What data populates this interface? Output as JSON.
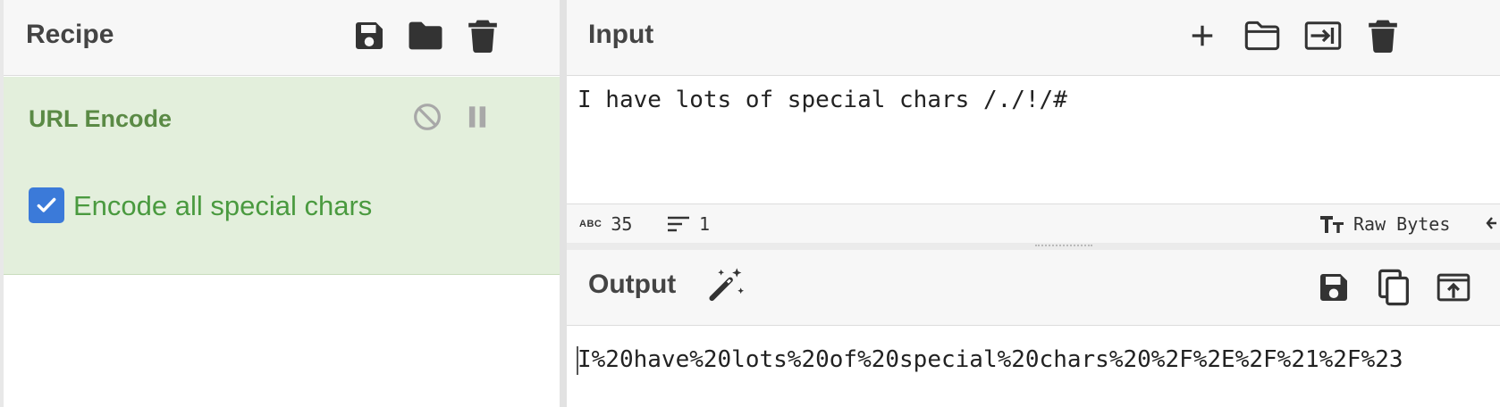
{
  "recipe": {
    "title": "Recipe",
    "icons": [
      "save-icon",
      "folder-icon",
      "trash-icon"
    ],
    "operation": {
      "name": "URL Encode",
      "disable_icon": "disable-icon",
      "pause_icon": "pause-icon",
      "option_label": "Encode all special chars",
      "option_checked": true
    }
  },
  "input": {
    "title": "Input",
    "icons": [
      "plus-icon",
      "folder-icon",
      "import-icon",
      "trash-icon"
    ],
    "text": "I have lots of special chars /./!/#",
    "status": {
      "char_count": "35",
      "line_count": "1",
      "abc_label": "ABC",
      "encoding": "Raw Bytes"
    }
  },
  "output": {
    "title": "Output",
    "magic_icon": "magic-wand-icon",
    "icons": [
      "save-icon",
      "copy-icon",
      "replace-input-icon"
    ],
    "text": "I%20have%20lots%20of%20special%20chars%20%2F%2E%2F%21%2F%23"
  },
  "colors": {
    "operation_bg": "#e3efdc",
    "operation_text": "#5a8a45",
    "checkbox": "#3b7ad9",
    "header_bg": "#f7f7f7"
  }
}
